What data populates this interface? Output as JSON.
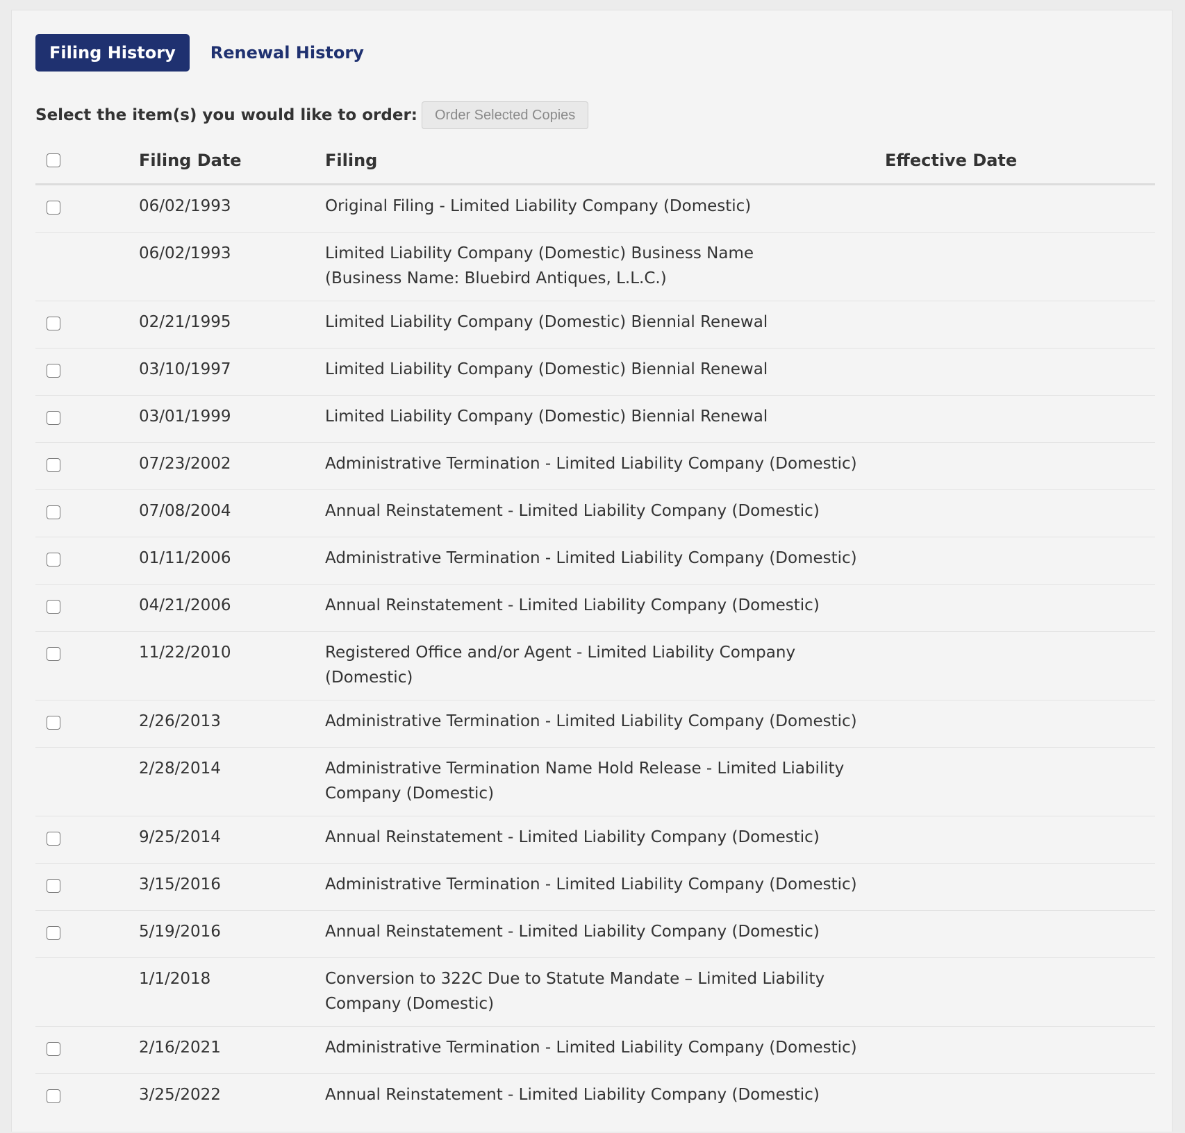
{
  "tabs": [
    {
      "label": "Filing History",
      "active": true
    },
    {
      "label": "Renewal History",
      "active": false
    }
  ],
  "order": {
    "prompt": "Select the item(s) you would like to order:",
    "button_label": "Order Selected Copies"
  },
  "table": {
    "headers": {
      "filing_date": "Filing Date",
      "filing": "Filing",
      "effective_date": "Effective Date"
    },
    "rows": [
      {
        "has_checkbox": true,
        "filing_date": "06/02/1993",
        "filing": "Original Filing - Limited Liability Company (Domestic)",
        "effective_date": ""
      },
      {
        "has_checkbox": false,
        "filing_date": "06/02/1993",
        "filing": "Limited Liability Company (Domestic) Business Name",
        "filing_line2": "(Business Name: Bluebird Antiques, L.L.C.)",
        "effective_date": ""
      },
      {
        "has_checkbox": true,
        "filing_date": "02/21/1995",
        "filing": "Limited Liability Company (Domestic) Biennial Renewal",
        "effective_date": ""
      },
      {
        "has_checkbox": true,
        "filing_date": "03/10/1997",
        "filing": "Limited Liability Company (Domestic) Biennial Renewal",
        "effective_date": ""
      },
      {
        "has_checkbox": true,
        "filing_date": "03/01/1999",
        "filing": "Limited Liability Company (Domestic) Biennial Renewal",
        "effective_date": ""
      },
      {
        "has_checkbox": true,
        "filing_date": "07/23/2002",
        "filing": "Administrative Termination - Limited Liability Company (Domestic)",
        "effective_date": ""
      },
      {
        "has_checkbox": true,
        "filing_date": "07/08/2004",
        "filing": "Annual Reinstatement - Limited Liability Company (Domestic)",
        "effective_date": ""
      },
      {
        "has_checkbox": true,
        "filing_date": "01/11/2006",
        "filing": "Administrative Termination - Limited Liability Company (Domestic)",
        "effective_date": ""
      },
      {
        "has_checkbox": true,
        "filing_date": "04/21/2006",
        "filing": "Annual Reinstatement - Limited Liability Company (Domestic)",
        "effective_date": ""
      },
      {
        "has_checkbox": true,
        "filing_date": "11/22/2010",
        "filing": "Registered Office and/or Agent - Limited Liability Company (Domestic)",
        "effective_date": ""
      },
      {
        "has_checkbox": true,
        "filing_date": "2/26/2013",
        "filing": "Administrative Termination - Limited Liability Company (Domestic)",
        "effective_date": ""
      },
      {
        "has_checkbox": false,
        "filing_date": "2/28/2014",
        "filing": "Administrative Termination Name Hold Release - Limited Liability",
        "filing_line2": "Company (Domestic)",
        "effective_date": ""
      },
      {
        "has_checkbox": true,
        "filing_date": "9/25/2014",
        "filing": "Annual Reinstatement - Limited Liability Company (Domestic)",
        "effective_date": ""
      },
      {
        "has_checkbox": true,
        "filing_date": "3/15/2016",
        "filing": "Administrative Termination - Limited Liability Company (Domestic)",
        "effective_date": ""
      },
      {
        "has_checkbox": true,
        "filing_date": "5/19/2016",
        "filing": "Annual Reinstatement - Limited Liability Company (Domestic)",
        "effective_date": ""
      },
      {
        "has_checkbox": false,
        "filing_date": "1/1/2018",
        "filing": "Conversion to 322C Due to Statute Mandate – Limited Liability",
        "filing_line2": "Company (Domestic)",
        "effective_date": ""
      },
      {
        "has_checkbox": true,
        "filing_date": "2/16/2021",
        "filing": "Administrative Termination - Limited Liability Company (Domestic)",
        "effective_date": ""
      },
      {
        "has_checkbox": true,
        "filing_date": "3/25/2022",
        "filing": "Annual Reinstatement - Limited Liability Company (Domestic)",
        "effective_date": ""
      }
    ]
  },
  "colors": {
    "accent": "#1f3170",
    "panel_bg": "#f4f4f4",
    "text": "#333333"
  }
}
